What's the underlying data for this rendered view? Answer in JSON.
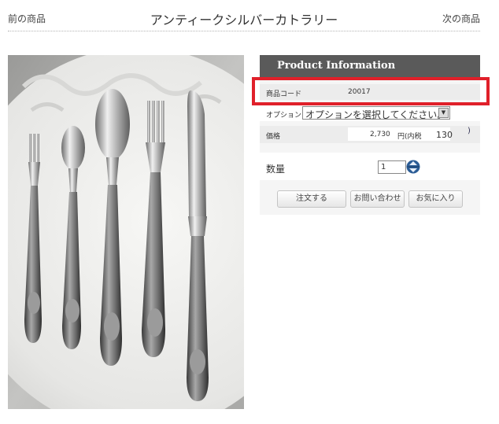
{
  "nav": {
    "prev": "前の商品",
    "title": "アンティークシルバーカトラリー",
    "next": "次の商品"
  },
  "panel": {
    "header": "Product Information",
    "code_label": "商品コード",
    "code_value": "20017",
    "option_label": "オプション",
    "option_selected": "オプションを選択してください。",
    "price_label": "価格",
    "price_value": "2,730",
    "price_tax_label": "円(内税",
    "price_tax_value": "130",
    "price_close": ")",
    "qty_label": "数量",
    "qty_value": "1"
  },
  "buttons": {
    "order": "注文する",
    "inquiry": "お問い合わせ",
    "favorite": "お気に入り"
  },
  "colors": {
    "header_bg": "#5a5a5a",
    "highlight": "#e0202a"
  },
  "icons": {
    "select": "chevron-down-icon",
    "spinner": "up-down-spinner-icon"
  }
}
